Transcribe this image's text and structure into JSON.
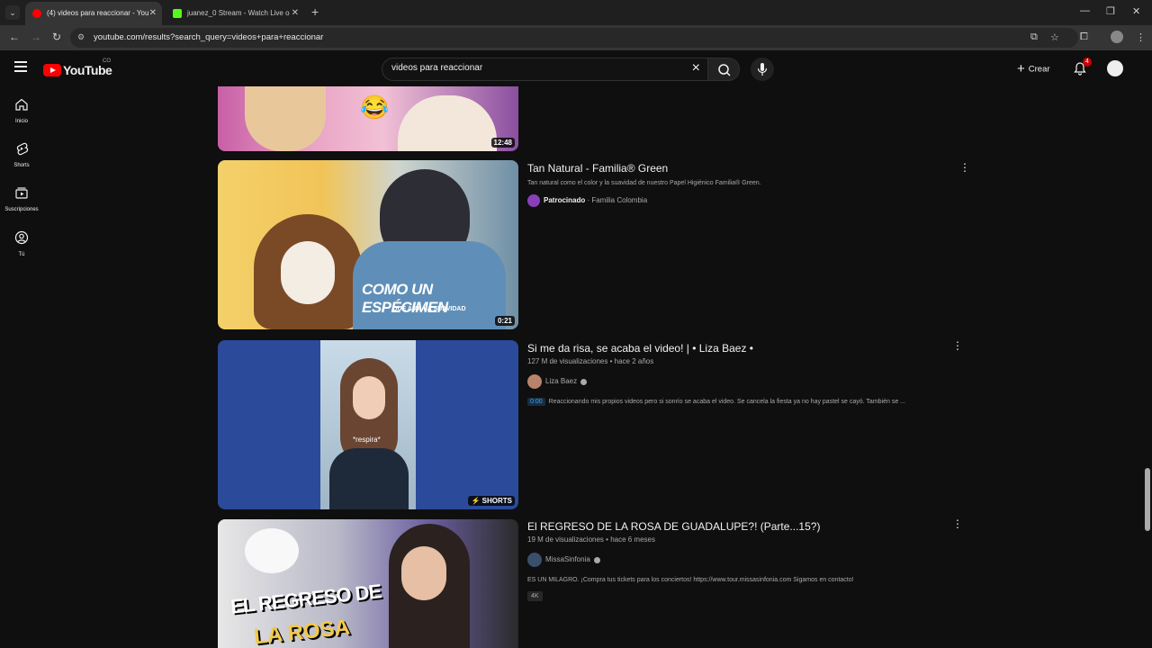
{
  "browser": {
    "tabs": [
      {
        "label": "(4) videos para reaccionar - You",
        "active": true
      },
      {
        "label": "juanez_0 Stream - Watch Live o",
        "active": false
      }
    ],
    "url": "youtube.com/results?search_query=videos+para+reaccionar"
  },
  "header": {
    "logo_text": "YouTube",
    "country_code": "CO",
    "search_value": "videos para reaccionar",
    "create_label": "Crear",
    "notification_count": "4"
  },
  "guide": [
    {
      "label": "Inicio",
      "icon": "home-icon"
    },
    {
      "label": "Shorts",
      "icon": "shorts-icon"
    },
    {
      "label": "Suscripciones",
      "icon": "subscriptions-icon"
    },
    {
      "label": "Tú",
      "icon": "you-icon"
    }
  ],
  "results": [
    {
      "duration": "12:48"
    },
    {
      "title": "Tan Natural - Familia® Green",
      "description": "Tan natural como el color y la suavidad de nuestro Papel Higiénico Familia® Green.",
      "sponsored_label": "Patrocinado",
      "channel": "Familia Colombia",
      "duration": "0:21",
      "overlay_text": "COMO UN ESPÉCIMEN",
      "overlay_sub": "QUE AMA LA SUAVIDAD"
    },
    {
      "title": "Si me da risa, se acaba el video! | • Liza Baez •",
      "views": "127 M de visualizaciones",
      "age": "hace 2 años",
      "channel": "Liza Baez",
      "timestamp": "0:00",
      "description": "Reaccionando mis propios videos pero si sonrío se acaba el video. Se cancela la fiesta ya no hay pastel se cayó. También se ...",
      "badge": "SHORTS",
      "caption": "*respira*"
    },
    {
      "title": "El REGRESO DE LA ROSA DE GUADALUPE?! (Parte...15?)",
      "views": "19 M de visualizaciones",
      "age": "hace 6 meses",
      "channel": "MissaSinfonia",
      "description": "ES UN MILAGRO. ¡Compra tus tickets para los conciertos! https://www.tour.missasinfonia.com Sigamos en contacto!",
      "chip": "4K",
      "thumb_text_1": "EL REGRESO DE",
      "thumb_text_2": "LA ROSA"
    }
  ]
}
